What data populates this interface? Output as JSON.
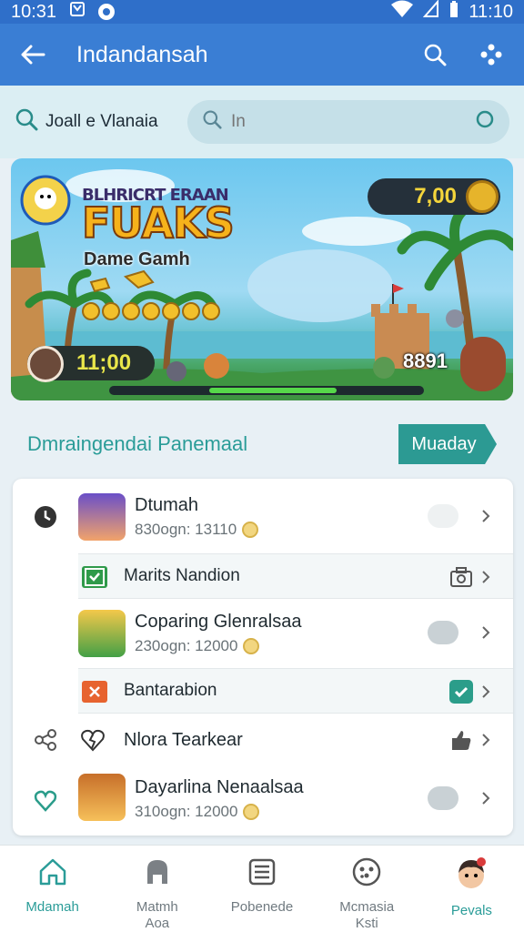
{
  "status_bar": {
    "time_left": "10:31",
    "time_right": "11:10"
  },
  "app_bar": {
    "title": "Indandansah"
  },
  "search": {
    "label": "Joall e Vlanaia",
    "placeholder": "In"
  },
  "banner": {
    "subtitle_top": "BLHRICRT ERAAN",
    "title": "FUAKS",
    "subtitle": "Dame Gamh",
    "score": "7,00",
    "timer": "11;00",
    "count": "8891",
    "progress": 0.25
  },
  "section": {
    "title": "Dmraingendai Panemaal",
    "button": "Muaday"
  },
  "list": {
    "items": [
      {
        "title": "Dtumah",
        "subtitle": "830ogn: 13110"
      },
      {
        "title": "Marits Nandion"
      },
      {
        "title": "Coparing Glenralsaa",
        "subtitle": "230ogn: 12000"
      },
      {
        "title": "Bantarabion"
      },
      {
        "title": "Nlora Tearkear"
      },
      {
        "title": "Dayarlina Nenaalsaa",
        "subtitle": "310ogn: 12000"
      }
    ]
  },
  "bottom_nav": [
    {
      "label": "Mdamah"
    },
    {
      "label": "Matmh\nAoa"
    },
    {
      "label": "Pobenede"
    },
    {
      "label": "Mcmasia\nKsti"
    },
    {
      "label": "Pevals"
    }
  ],
  "colors": {
    "primary": "#3a7ed4",
    "accent": "#2c9a93",
    "status_bar": "#2f6fc9"
  }
}
